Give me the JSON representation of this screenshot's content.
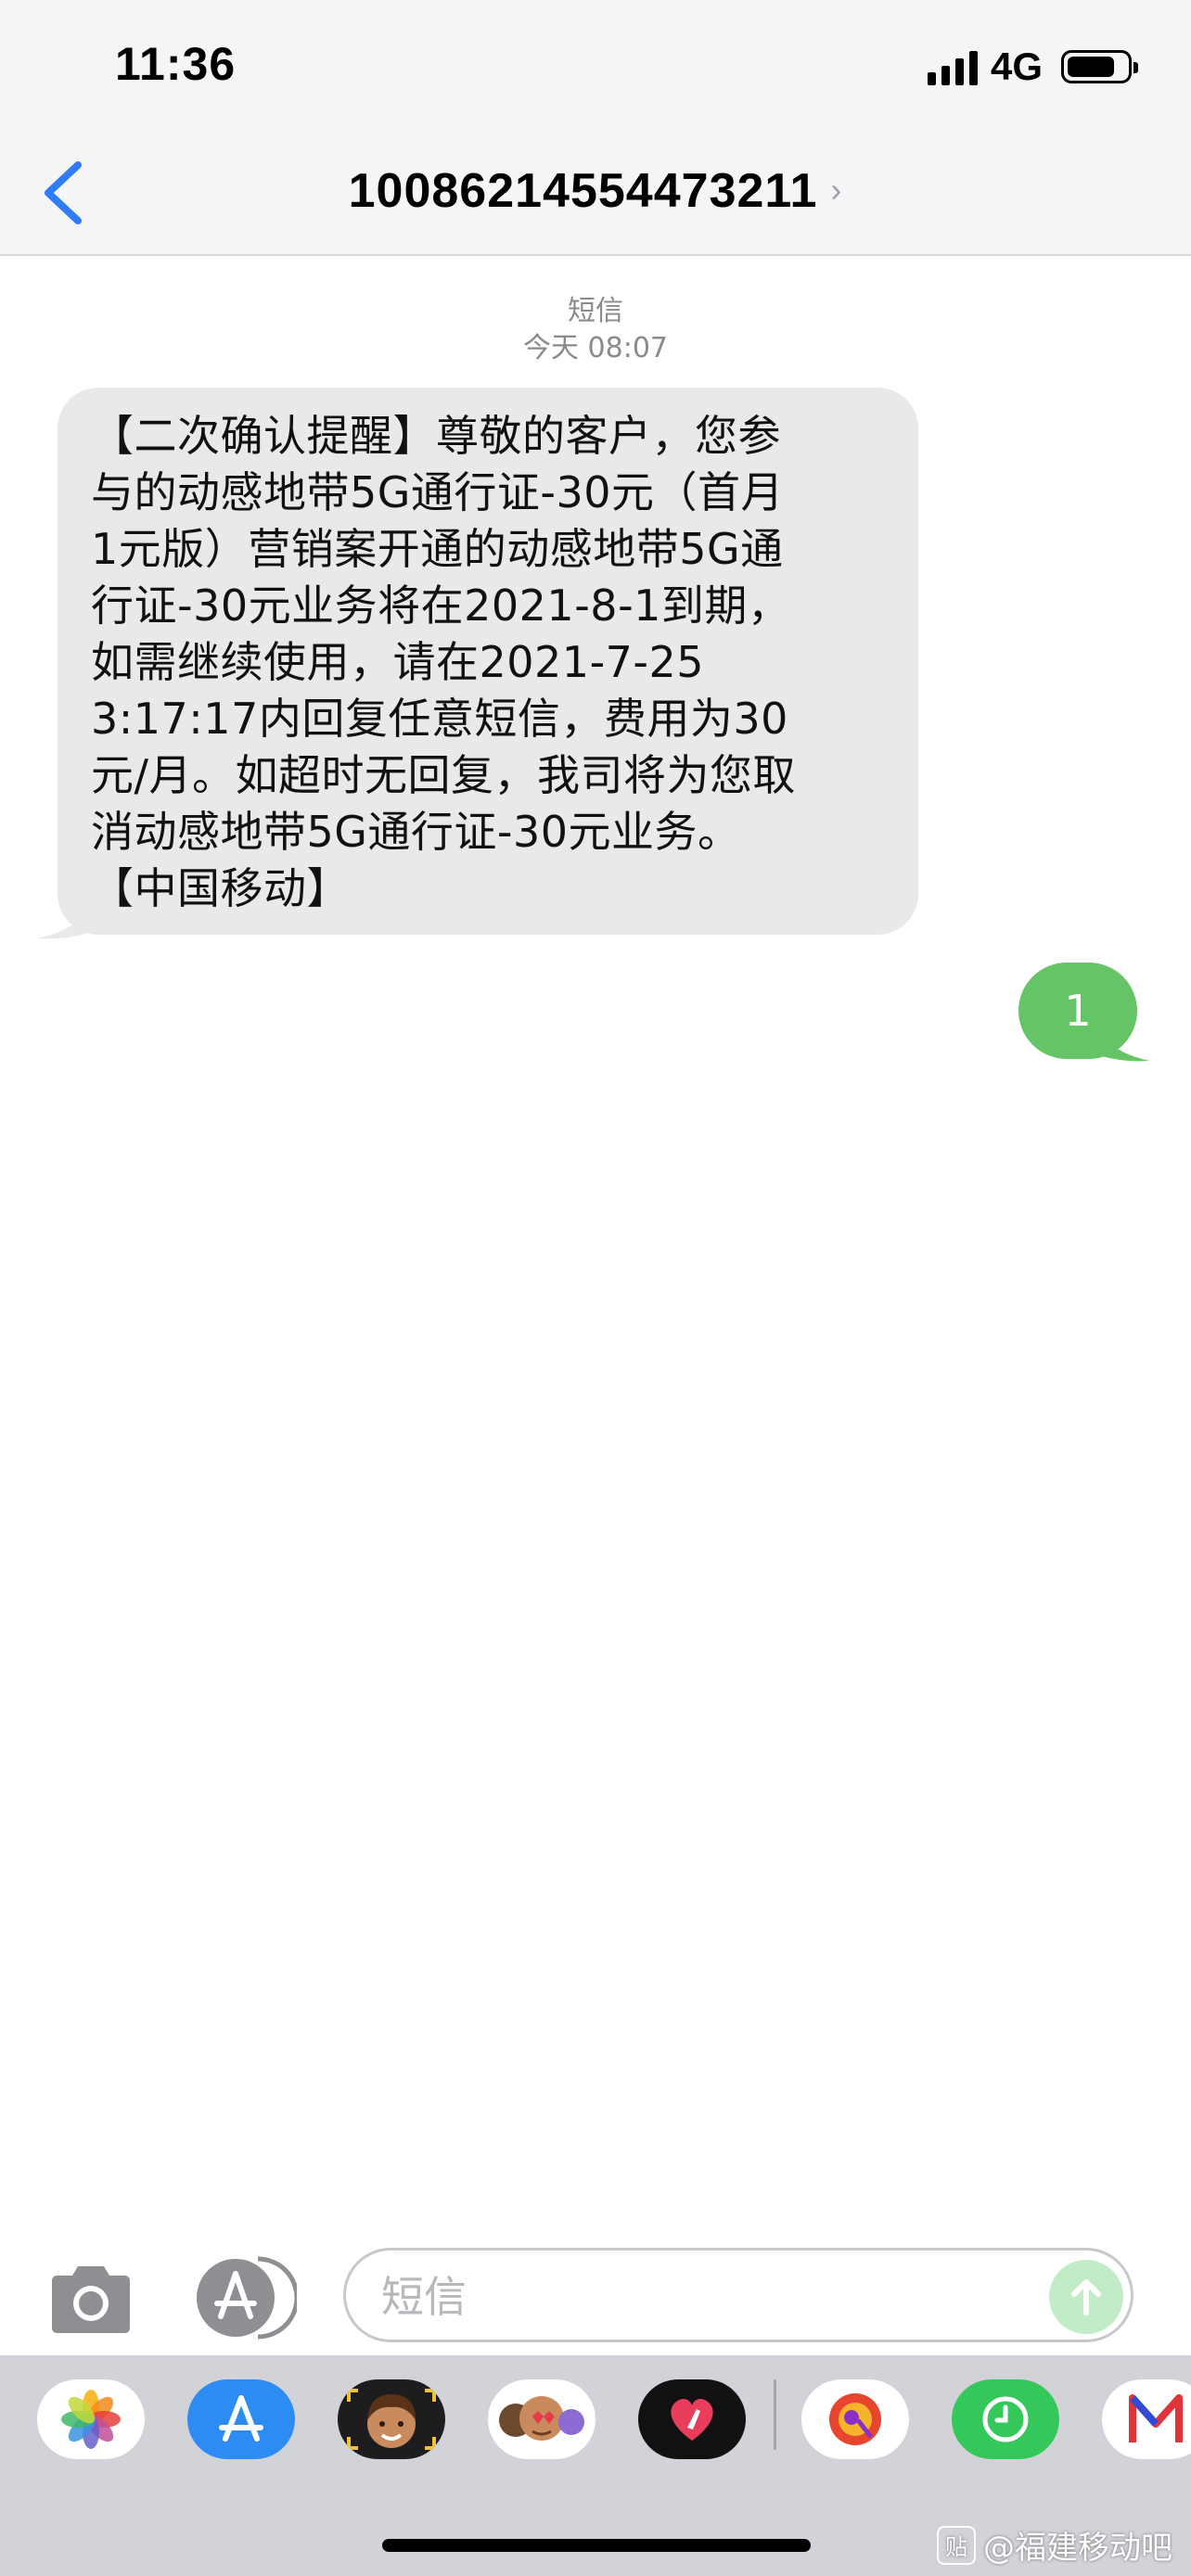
{
  "status_bar": {
    "time": "11:36",
    "network": "4G",
    "battery_level": 0.8
  },
  "header": {
    "contact": "10086214554473211"
  },
  "conversation": {
    "service_label": "短信",
    "timestamp": "今天 08:07",
    "incoming_message": "【二次确认提醒】尊敬的客户，您参\n与的动感地带5G通行证-30元（首月\n1元版）营销案开通的动感地带5G通\n行证-30元业务将在2021-8-1到期，\n如需继续使用，请在2021-7-25\n3:17:17内回复任意短信，费用为30\n元/月。如超时无回复，我司将为您取\n消动感地带5G通行证-30元业务。\n【中国移动】",
    "outgoing_message": "1"
  },
  "input_bar": {
    "placeholder": "短信"
  },
  "app_drawer": {
    "apps": [
      "photos-icon",
      "app-store-icon",
      "memoji-icon",
      "animoji-icon",
      "digital-touch-icon",
      "music-icon",
      "clock-icon",
      "news-icon"
    ]
  },
  "colors": {
    "accent_blue": "#2f7cf6",
    "bubble_green": "#65c466",
    "bubble_gray": "#e9e9eb"
  },
  "watermark": {
    "text": "@福建移动吧",
    "badge": "贴"
  }
}
